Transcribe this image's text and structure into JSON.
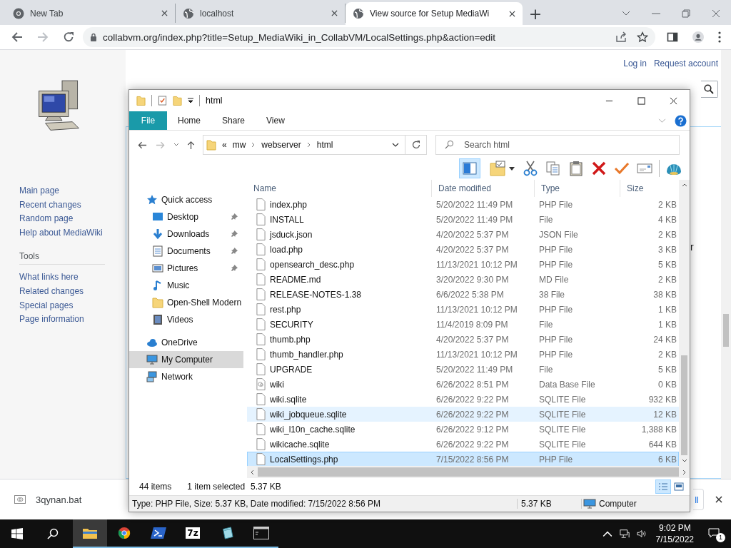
{
  "browser": {
    "tabs": [
      {
        "title": "New Tab",
        "kind": "chrome",
        "selected": false
      },
      {
        "title": "localhost",
        "kind": "globe",
        "selected": false
      },
      {
        "title": "View source for Setup MediaWi",
        "kind": "globe",
        "selected": true
      }
    ],
    "new_tab": "+",
    "url": "collabvm.org/index.php?title=Setup_MediaWiki_in_CollabVM/LocalSettings.php&action=edit"
  },
  "wiki": {
    "user_links": [
      "Log in",
      "Request account"
    ],
    "navigation": [
      "Main page",
      "Recent changes",
      "Random page",
      "Help about MediaWiki"
    ],
    "tools_heading": "Tools",
    "tools": [
      "What links here",
      "Related changes",
      "Special pages",
      "Page information"
    ],
    "content_fragment": "r"
  },
  "explorer": {
    "title": "html",
    "ribbon_tabs": [
      {
        "label": "File",
        "selected": true
      },
      {
        "label": "Home",
        "selected": false
      },
      {
        "label": "Share",
        "selected": false
      },
      {
        "label": "View",
        "selected": false
      }
    ],
    "breadcrumb_overflow": "«",
    "breadcrumb": [
      "mw",
      "webserver",
      "html"
    ],
    "search_placeholder": "Search html",
    "preview_pane": true,
    "nav_pane": [
      {
        "label": "Quick access",
        "kind": "star",
        "selected": false,
        "children": [
          {
            "label": "Desktop",
            "kind": "desktop",
            "pinned": true,
            "selected": false
          },
          {
            "label": "Downloads",
            "kind": "downloads",
            "pinned": true,
            "selected": false
          },
          {
            "label": "Documents",
            "kind": "documents",
            "pinned": true,
            "selected": false
          },
          {
            "label": "Pictures",
            "kind": "pictures",
            "pinned": true,
            "selected": false
          },
          {
            "label": "Music",
            "kind": "music",
            "pinned": false,
            "selected": false
          },
          {
            "label": "Open-Shell Modern",
            "kind": "folder",
            "pinned": false,
            "selected": false
          },
          {
            "label": "Videos",
            "kind": "videos",
            "pinned": false,
            "selected": false
          }
        ]
      },
      {
        "label": "OneDrive",
        "kind": "cloud",
        "selected": false
      },
      {
        "label": "My Computer",
        "kind": "computer",
        "selected": true
      },
      {
        "label": "Network",
        "kind": "network",
        "selected": false
      }
    ],
    "columns": [
      "Name",
      "Date modified",
      "Type",
      "Size"
    ],
    "files": [
      {
        "name": "index.php",
        "date": "5/20/2022 11:49 PM",
        "type": "PHP File",
        "size": "2 KB",
        "kind": "file",
        "selected": false,
        "hovered": false
      },
      {
        "name": "INSTALL",
        "date": "5/20/2022 11:49 PM",
        "type": "File",
        "size": "4 KB",
        "kind": "file",
        "selected": false,
        "hovered": false
      },
      {
        "name": "jsduck.json",
        "date": "4/20/2022 5:37 PM",
        "type": "JSON File",
        "size": "2 KB",
        "kind": "file",
        "selected": false,
        "hovered": false
      },
      {
        "name": "load.php",
        "date": "4/20/2022 5:37 PM",
        "type": "PHP File",
        "size": "3 KB",
        "kind": "file",
        "selected": false,
        "hovered": false
      },
      {
        "name": "opensearch_desc.php",
        "date": "11/13/2021 10:12 PM",
        "type": "PHP File",
        "size": "5 KB",
        "kind": "file",
        "selected": false,
        "hovered": false
      },
      {
        "name": "README.md",
        "date": "3/20/2022 9:30 PM",
        "type": "MD File",
        "size": "2 KB",
        "kind": "file",
        "selected": false,
        "hovered": false
      },
      {
        "name": "RELEASE-NOTES-1.38",
        "date": "6/6/2022 5:38 PM",
        "type": "38 File",
        "size": "38 KB",
        "kind": "file",
        "selected": false,
        "hovered": false
      },
      {
        "name": "rest.php",
        "date": "11/13/2021 10:12 PM",
        "type": "PHP File",
        "size": "1 KB",
        "kind": "file",
        "selected": false,
        "hovered": false
      },
      {
        "name": "SECURITY",
        "date": "11/4/2019 8:09 PM",
        "type": "File",
        "size": "1 KB",
        "kind": "file",
        "selected": false,
        "hovered": false
      },
      {
        "name": "thumb.php",
        "date": "4/20/2022 5:37 PM",
        "type": "PHP File",
        "size": "24 KB",
        "kind": "file",
        "selected": false,
        "hovered": false
      },
      {
        "name": "thumb_handler.php",
        "date": "11/13/2021 10:12 PM",
        "type": "PHP File",
        "size": "2 KB",
        "kind": "file",
        "selected": false,
        "hovered": false
      },
      {
        "name": "UPGRADE",
        "date": "5/20/2022 11:49 PM",
        "type": "File",
        "size": "5 KB",
        "kind": "file",
        "selected": false,
        "hovered": false
      },
      {
        "name": "wiki",
        "date": "6/26/2022 8:51 PM",
        "type": "Data Base File",
        "size": "0 KB",
        "kind": "database",
        "selected": false,
        "hovered": false
      },
      {
        "name": "wiki.sqlite",
        "date": "6/26/2022 9:22 PM",
        "type": "SQLITE File",
        "size": "932 KB",
        "kind": "file",
        "selected": false,
        "hovered": false
      },
      {
        "name": "wiki_jobqueue.sqlite",
        "date": "6/26/2022 9:22 PM",
        "type": "SQLITE File",
        "size": "12 KB",
        "kind": "file",
        "selected": false,
        "hovered": true
      },
      {
        "name": "wiki_l10n_cache.sqlite",
        "date": "6/26/2022 9:12 PM",
        "type": "SQLITE File",
        "size": "1,388 KB",
        "kind": "file",
        "selected": false,
        "hovered": false
      },
      {
        "name": "wikicache.sqlite",
        "date": "6/26/2022 9:22 PM",
        "type": "SQLITE File",
        "size": "644 KB",
        "kind": "file",
        "selected": false,
        "hovered": false
      },
      {
        "name": "LocalSettings.php",
        "date": "7/15/2022 8:56 PM",
        "type": "PHP File",
        "size": "6 KB",
        "kind": "file",
        "selected": true,
        "hovered": false
      }
    ],
    "status": {
      "items": "44 items",
      "selection": "1 item selected",
      "selection_size": "5.37 KB"
    },
    "view_buttons": [
      {
        "kind": "details",
        "selected": true
      },
      {
        "kind": "large_icons",
        "selected": false
      }
    ],
    "details": {
      "description": "Type: PHP File, Size: 5.37 KB, Date modified: 7/15/2022 8:56 PM",
      "size": "5.37 KB",
      "location": "Computer"
    }
  },
  "downloads": {
    "file": "3qynan.bat",
    "button_fragment": "ll"
  },
  "taskbar": {
    "apps": [
      {
        "kind": "explorer",
        "active": true
      },
      {
        "kind": "chrome",
        "active": false
      },
      {
        "kind": "powershell",
        "active": false
      },
      {
        "kind": "sevenzip",
        "active": false
      },
      {
        "kind": "notepad",
        "active": false
      },
      {
        "kind": "cmd",
        "active": false
      }
    ],
    "seven_zip_label": "7z",
    "time": "9:02 PM",
    "date": "7/15/2022",
    "notifications": "1"
  }
}
